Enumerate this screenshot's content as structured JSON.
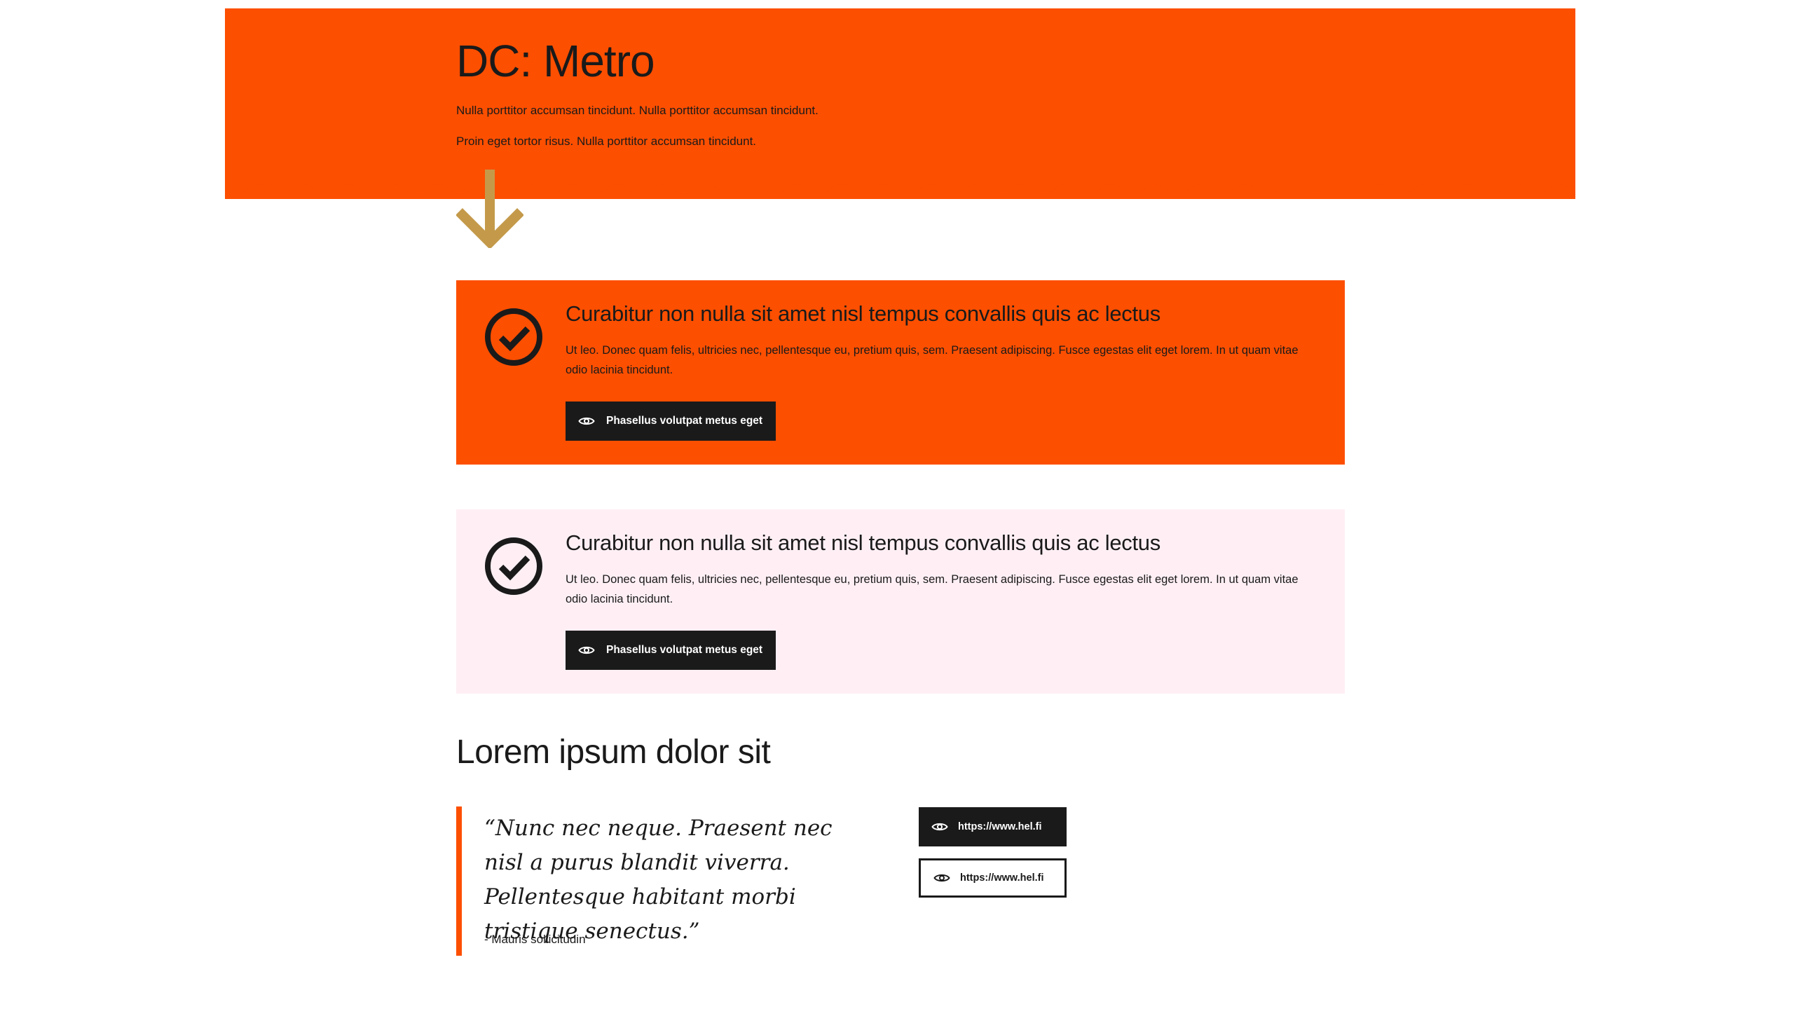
{
  "colors": {
    "brand": "#fd4f00",
    "pink": "#ffeff5",
    "dark": "#1a1a1a",
    "arrow": "#c49a4a"
  },
  "hero": {
    "title": "DC: Metro",
    "line1": "Nulla porttitor accumsan tincidunt. Nulla porttitor accumsan tincidunt.",
    "line2": "Proin eget tortor risus. Nulla porttitor accumsan tincidunt."
  },
  "cards": [
    {
      "title": "Curabitur non nulla sit amet nisl tempus convallis quis ac lectus",
      "body": "Ut leo. Donec quam felis, ultricies nec, pellentesque eu, pretium quis, sem. Praesent adipiscing. Fusce egestas elit eget lorem. In ut quam vitae odio lacinia tincidunt.",
      "button": "Phasellus volutpat metus eget",
      "icon": "check-circle-icon"
    },
    {
      "title": "Curabitur non nulla sit amet nisl tempus convallis quis ac lectus",
      "body": "Ut leo. Donec quam felis, ultricies nec, pellentesque eu, pretium quis, sem. Praesent adipiscing. Fusce egestas elit eget lorem. In ut quam vitae odio lacinia tincidunt.",
      "button": "Phasellus volutpat metus eget",
      "icon": "check-circle-icon"
    }
  ],
  "section": {
    "title": "Lorem ipsum dolor sit",
    "quote": "“Nunc nec neque. Praesent nec nisl a purus blandit viverra. Pellentesque habitant morbi tristique senectus.”",
    "author": "- Mauris sollicitudin",
    "links": [
      {
        "label": "https://www.hel.fi",
        "icon": "eye-icon",
        "style": "dark"
      },
      {
        "label": "https://www.hel.fi",
        "icon": "eye-icon",
        "style": "outline"
      }
    ]
  }
}
